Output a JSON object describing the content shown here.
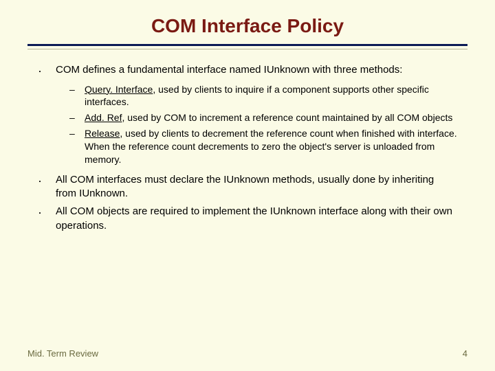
{
  "title": "COM Interface Policy",
  "bullet1": {
    "text": "COM defines a fundamental interface named IUnknown with three methods:",
    "subs": [
      {
        "name": "Query. Interface",
        "rest": ", used by clients to inquire if a component supports other specific interfaces."
      },
      {
        "name": "Add. Ref",
        "rest": ", used by COM to increment a reference count maintained by all COM objects"
      },
      {
        "name": "Release",
        "rest": ", used by clients to decrement the reference count when finished with interface.  When the reference count decrements to zero the object's server is unloaded from memory."
      }
    ]
  },
  "bullet2": "All COM interfaces must declare the IUnknown methods, usually done by inheriting from IUnknown.",
  "bullet3": "All COM objects are required to implement the IUnknown interface along with their own operations.",
  "footer_left": "Mid. Term Review",
  "footer_right": "4"
}
